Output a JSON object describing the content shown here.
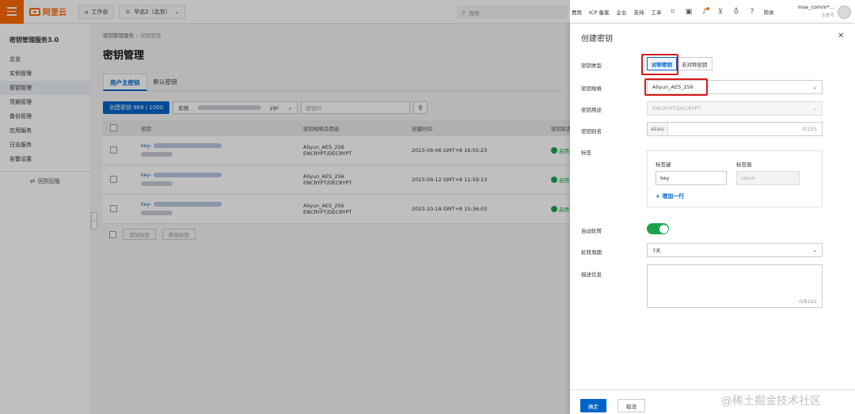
{
  "topbar": {
    "home": "工作台",
    "region": "华北2（北京）",
    "search_placeholder": "搜索",
    "links": [
      "费用",
      "ICP 备案",
      "企业",
      "支持",
      "工单"
    ],
    "lang": "简体",
    "account": "mse_comm*...",
    "account_role": "主账号"
  },
  "sidebar": {
    "title": "密钥管理服务3.0",
    "items": [
      "总览",
      "实例管理",
      "密钥管理",
      "凭据管理",
      "备份管理",
      "应用服务",
      "日志服务",
      "告警设置"
    ],
    "active_index": 2,
    "back_old": "回到旧版"
  },
  "main": {
    "breadcrumb": [
      "密钥管理服务",
      "密钥管理"
    ],
    "title": "密钥管理",
    "tabs": [
      "用户主密钥",
      "默认密钥"
    ],
    "create_button": "创建密钥 969 / 1000",
    "instance_prefix": "实例",
    "instance_suffix": "ygc",
    "search_placeholder": "密钥ID",
    "columns": [
      "密钥",
      "密钥规格及用途",
      "创建时间",
      "密钥状态"
    ],
    "rows": [
      {
        "key_prefix": "key-",
        "spec": "Aliyun_AES_256",
        "usage": "ENCRYPT/DECRYPT",
        "created": "2023-09-06 GMT+8 16:55:23",
        "status": "启用"
      },
      {
        "key_prefix": "key-",
        "spec": "Aliyun_AES_256",
        "usage": "ENCRYPT/DECRYPT",
        "created": "2023-09-12 GMT+8 11:59:13",
        "status": "启用"
      },
      {
        "key_prefix": "key-",
        "spec": "Aliyun_AES_256",
        "usage": "ENCRYPT/DECRYPT",
        "created": "2023-10-18 GMT+8 15:36:03",
        "status": "启用"
      }
    ],
    "bulk": [
      "增加标签",
      "删除标签"
    ]
  },
  "panel": {
    "title": "创建密钥",
    "labels": {
      "type": "密钥类型",
      "spec": "密钥规格",
      "usage": "密钥用途",
      "alias": "密钥别名",
      "tags": "标签",
      "auto_rotate": "自动轮转",
      "period": "轮转周期",
      "description": "描述信息"
    },
    "type_options": [
      "对称密钥",
      "非对称密钥"
    ],
    "type_selected": 0,
    "spec_value": "Aliyun_AES_256",
    "usage_value": "ENCRYPT/DECRYPT",
    "alias_prefix": "alias/",
    "alias_count": "0/255",
    "tag_key_header": "标签键",
    "tag_value_header": "标签值",
    "tag_key_placeholder": "key",
    "tag_value_placeholder": "value",
    "add_row": "增加一行",
    "auto_rotate_on": true,
    "period_value": "7天",
    "desc_count": "0/8192",
    "ok_button": "确定",
    "cancel_button": "取消"
  },
  "watermark": "@稀土掘金技术社区",
  "colors": {
    "brand": "#ff6a00",
    "primary": "#0064c8",
    "success": "#1ba34a",
    "highlight": "#d6191b"
  }
}
